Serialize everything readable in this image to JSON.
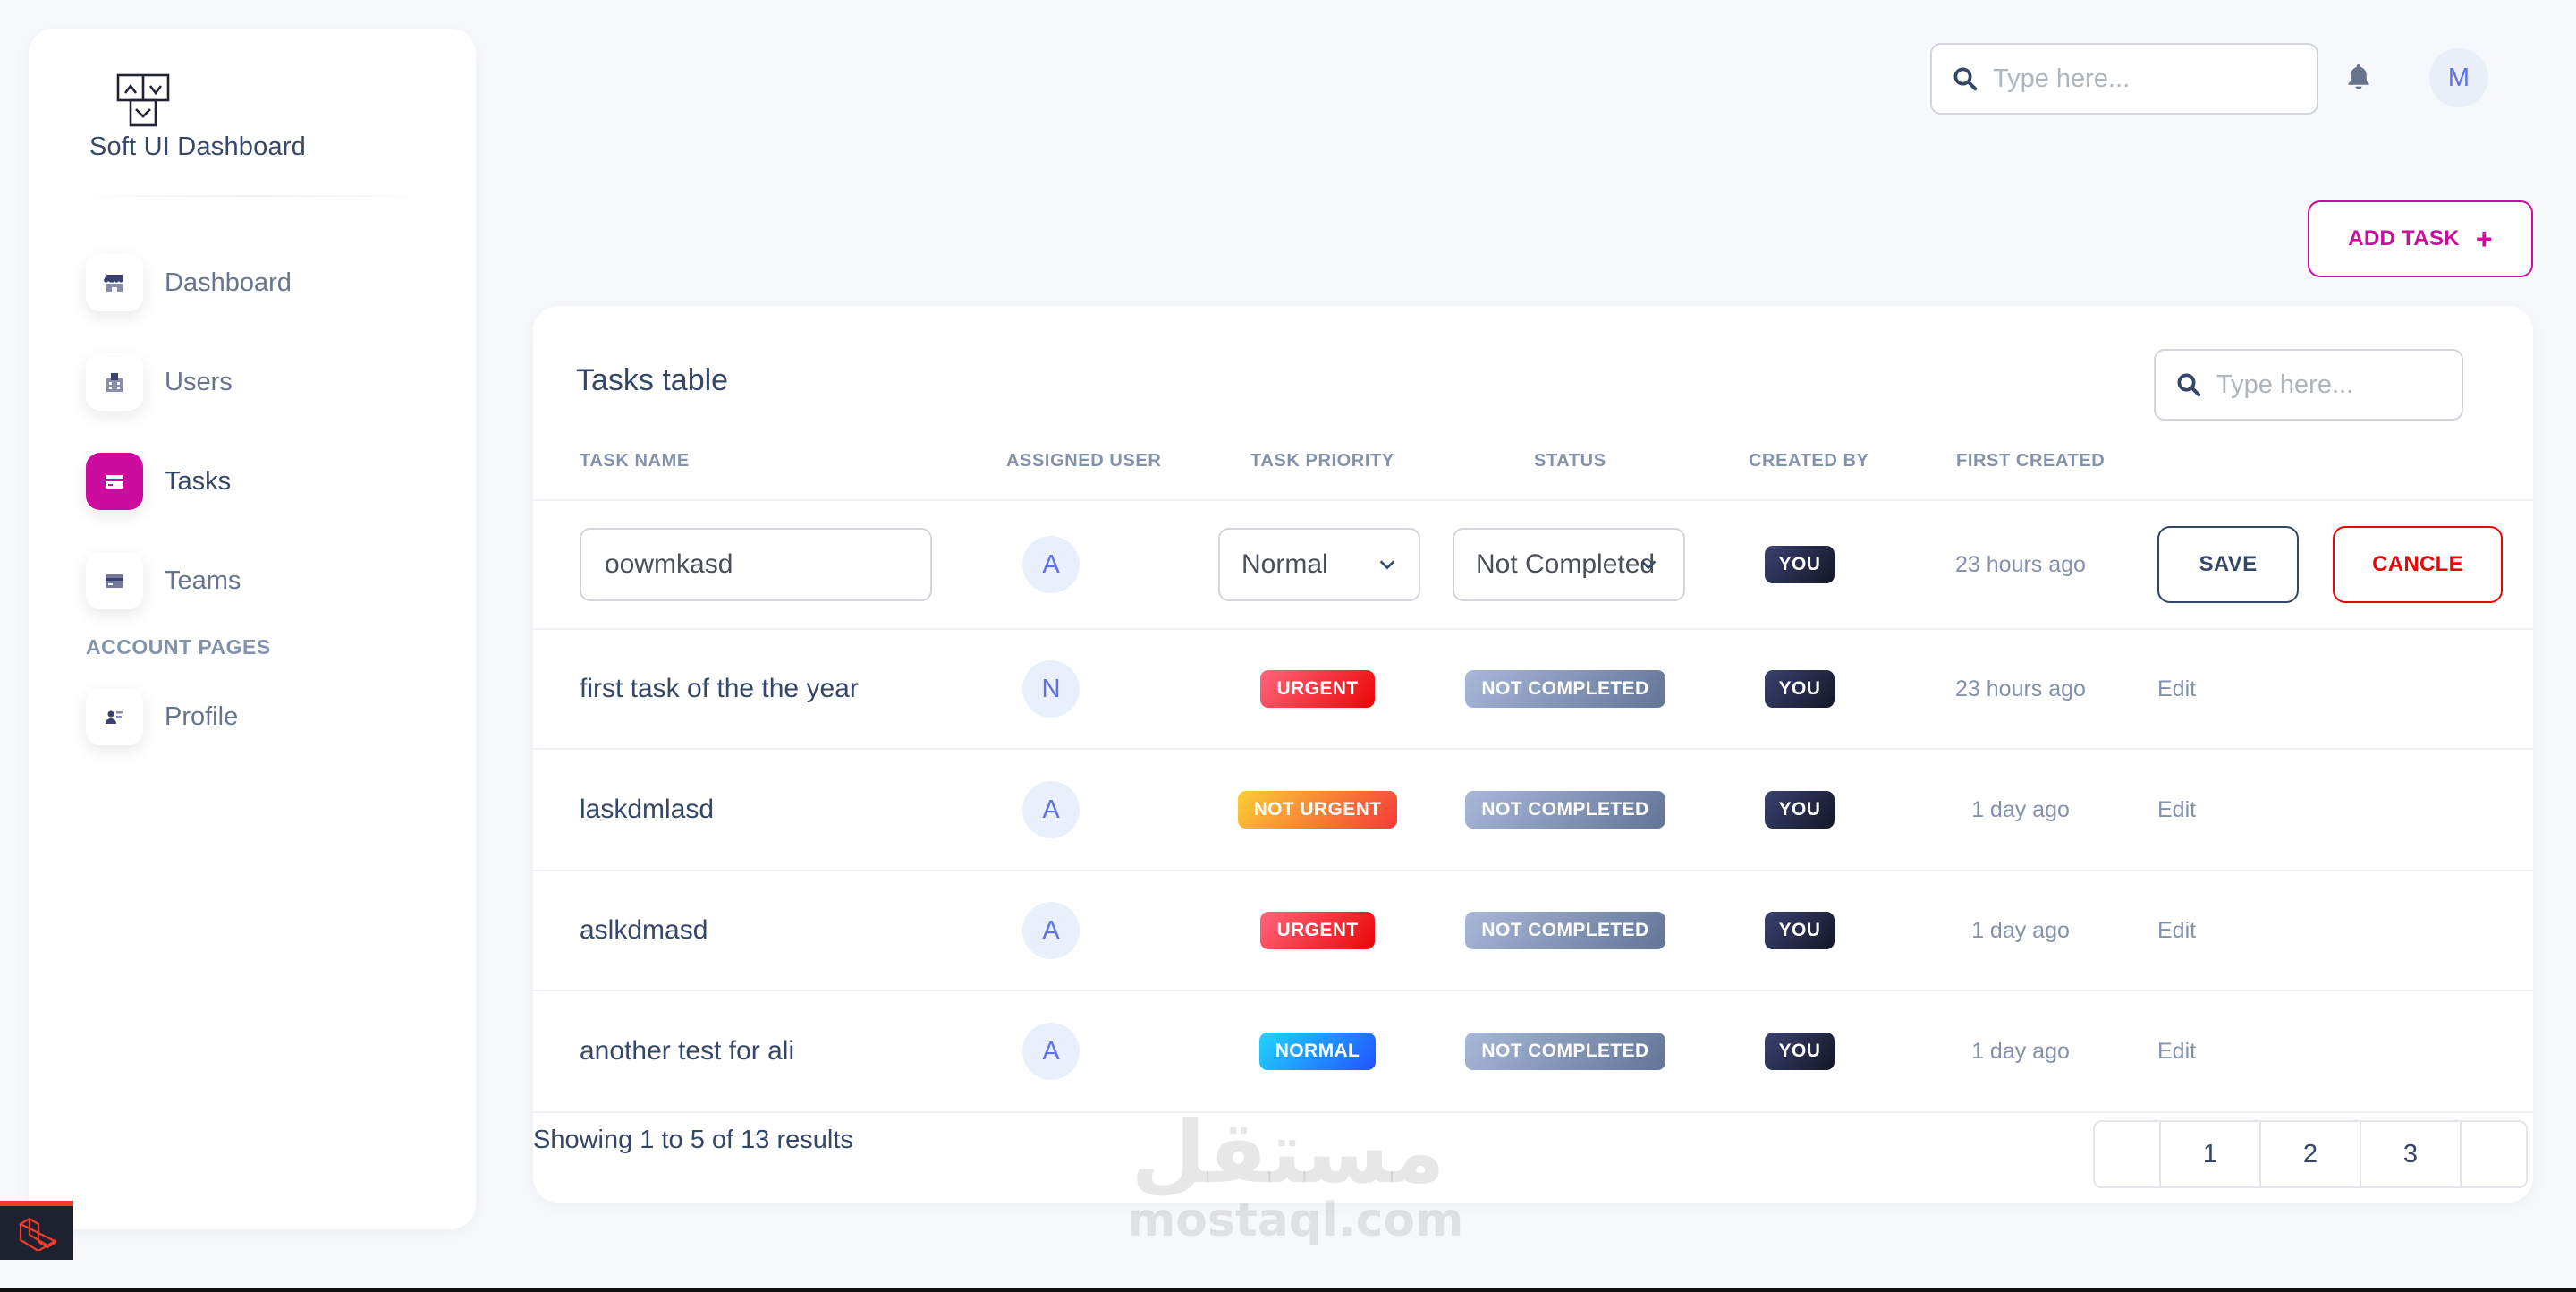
{
  "brand": {
    "name": "Soft UI Dashboard",
    "logo_icon": "layout-icon"
  },
  "sidebar": {
    "items": [
      {
        "label": "Dashboard",
        "icon": "shop-icon",
        "active": false
      },
      {
        "label": "Users",
        "icon": "office-icon",
        "active": false
      },
      {
        "label": "Tasks",
        "icon": "credit-card-icon",
        "active": true
      },
      {
        "label": "Teams",
        "icon": "credit-card-icon",
        "active": false
      }
    ],
    "section_title": "ACCOUNT PAGES",
    "account_items": [
      {
        "label": "Profile",
        "icon": "user-card-icon"
      }
    ]
  },
  "topbar": {
    "search_placeholder": "Type here...",
    "notification_icon": "bell-icon",
    "avatar_letter": "M"
  },
  "add_task": {
    "label": "ADD TASK",
    "icon": "plus-icon"
  },
  "table": {
    "title": "Tasks table",
    "search_placeholder": "Type here...",
    "columns": [
      "TASK NAME",
      "ASSIGNED USER",
      "TASK PRIORITY",
      "STATUS",
      "CREATED BY",
      "FIRST CREATED"
    ],
    "edit_row": {
      "task_name_value": "oowmkasd",
      "assigned_user": "A",
      "priority_value": "Normal",
      "status_value": "Not Completed",
      "created_by": "YOU",
      "first_created": "23 hours ago",
      "save_label": "SAVE",
      "cancel_label": "CANCLE"
    },
    "rows": [
      {
        "task_name": "first task of the the year",
        "assigned_user": "N",
        "priority": "URGENT",
        "priority_style": "urgent",
        "status": "NOT COMPLETED",
        "created_by": "YOU",
        "first_created": "23 hours ago",
        "action": "Edit"
      },
      {
        "task_name": "laskdmlasd",
        "assigned_user": "A",
        "priority": "NOT URGENT",
        "priority_style": "noturgent",
        "status": "NOT COMPLETED",
        "created_by": "YOU",
        "first_created": "1 day ago",
        "action": "Edit"
      },
      {
        "task_name": "aslkdmasd",
        "assigned_user": "A",
        "priority": "URGENT",
        "priority_style": "urgent",
        "status": "NOT COMPLETED",
        "created_by": "YOU",
        "first_created": "1 day ago",
        "action": "Edit"
      },
      {
        "task_name": "another test for ali",
        "assigned_user": "A",
        "priority": "NORMAL",
        "priority_style": "normal",
        "status": "NOT COMPLETED",
        "created_by": "YOU",
        "first_created": "1 day ago",
        "action": "Edit"
      }
    ],
    "showing_text": "Showing 1 to 5 of 13 results",
    "pages": [
      "1",
      "2",
      "3"
    ]
  },
  "watermark": {
    "arabic": "مستقل",
    "latin": "mostaql.com"
  },
  "colors": {
    "accent": "#cb0c9f",
    "danger": "#ea0606",
    "text_dark": "#344767",
    "text_muted": "#8392ab"
  }
}
